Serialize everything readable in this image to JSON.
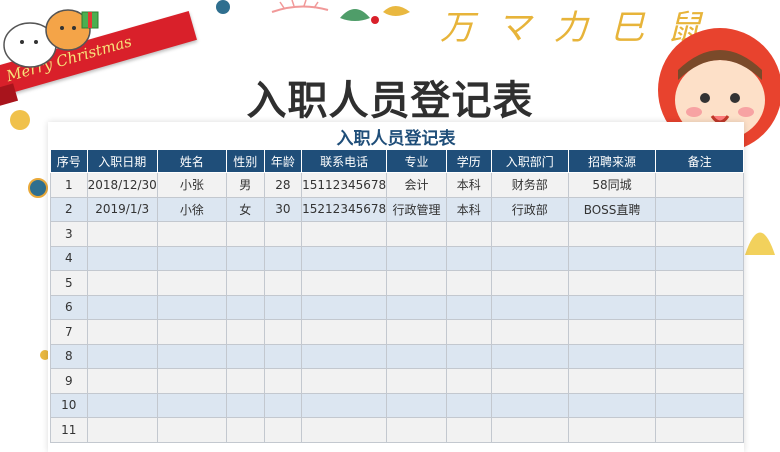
{
  "decor": {
    "banner_text": "Merry Christmas",
    "doodle_text": "万 マ 力 巳 鼠"
  },
  "header": {
    "main_title": "入职人员登记表"
  },
  "sheet": {
    "title": "入职人员登记表",
    "columns": [
      "序号",
      "入职日期",
      "姓名",
      "性别",
      "年龄",
      "联系电话",
      "专业",
      "学历",
      "入职部门",
      "招聘来源",
      "备注"
    ],
    "rows": [
      [
        "1",
        "2018/12/30",
        "小张",
        "男",
        "28",
        "15112345678",
        "会计",
        "本科",
        "财务部",
        "58同城",
        ""
      ],
      [
        "2",
        "2019/1/3",
        "小徐",
        "女",
        "30",
        "15212345678",
        "行政管理",
        "本科",
        "行政部",
        "BOSS直聘",
        ""
      ],
      [
        "3",
        "",
        "",
        "",
        "",
        "",
        "",
        "",
        "",
        "",
        ""
      ],
      [
        "4",
        "",
        "",
        "",
        "",
        "",
        "",
        "",
        "",
        "",
        ""
      ],
      [
        "5",
        "",
        "",
        "",
        "",
        "",
        "",
        "",
        "",
        "",
        ""
      ],
      [
        "6",
        "",
        "",
        "",
        "",
        "",
        "",
        "",
        "",
        "",
        ""
      ],
      [
        "7",
        "",
        "",
        "",
        "",
        "",
        "",
        "",
        "",
        "",
        ""
      ],
      [
        "8",
        "",
        "",
        "",
        "",
        "",
        "",
        "",
        "",
        "",
        ""
      ],
      [
        "9",
        "",
        "",
        "",
        "",
        "",
        "",
        "",
        "",
        "",
        ""
      ],
      [
        "10",
        "",
        "",
        "",
        "",
        "",
        "",
        "",
        "",
        "",
        ""
      ],
      [
        "11",
        "",
        "",
        "",
        "",
        "",
        "",
        "",
        "",
        "",
        ""
      ]
    ]
  }
}
